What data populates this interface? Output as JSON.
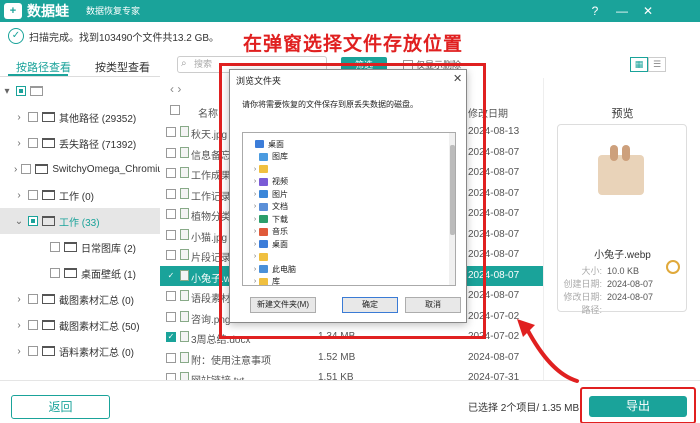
{
  "app": {
    "logo_glyph": "+",
    "title": "数据蛙",
    "subtitle": "数据恢复专家",
    "help_icon": "help-icon",
    "min_icon": "minimize-icon",
    "close_icon": "close-icon"
  },
  "scan": {
    "status": "扫描完成。找到103490个文件共13.2 GB。"
  },
  "annotation": {
    "caption": "在弹窗选择文件存放位置",
    "color": "#e02020"
  },
  "tabs": [
    {
      "label": "按路径查看",
      "active": true
    },
    {
      "label": "按类型查看",
      "active": false
    }
  ],
  "toolbar": {
    "search_placeholder": "搜索",
    "filter_label": "筛选",
    "only_deleted_label": "仅显示删除",
    "views": [
      "▦",
      "☰"
    ]
  },
  "sidebar": {
    "items": [
      {
        "label": "",
        "level": 0,
        "chevron": "▾",
        "check": "partial"
      },
      {
        "label": "其他路径 (29352)",
        "level": 1,
        "chevron": "›",
        "check": "none"
      },
      {
        "label": "丢失路径 (71392)",
        "level": 1,
        "chevron": "›",
        "check": "none"
      },
      {
        "label": "SwitchyOmega_Chromium",
        "level": 1,
        "chevron": "›",
        "check": "none"
      },
      {
        "label": "工作 (0)",
        "level": 1,
        "chevron": "›",
        "check": "none"
      },
      {
        "label": "工作 (33)",
        "level": 1,
        "chevron": "⌄",
        "check": "partial",
        "active": true
      },
      {
        "label": "日常图库 (2)",
        "level": 2,
        "chevron": "",
        "check": "none"
      },
      {
        "label": "桌面壁纸 (1)",
        "level": 2,
        "chevron": "",
        "check": "none"
      },
      {
        "label": "截图素材汇总 (0)",
        "level": 1,
        "chevron": "›",
        "check": "none"
      },
      {
        "label": "截图素材汇总 (50)",
        "level": 1,
        "chevron": "›",
        "check": "none"
      },
      {
        "label": "语料素材汇总 (0)",
        "level": 1,
        "chevron": "›",
        "check": "none"
      }
    ]
  },
  "filelist": {
    "nav": "‹   ›",
    "header": {
      "name": "名称",
      "date": "修改日期"
    },
    "rows": [
      {
        "name": "秋天.jpg",
        "size": "",
        "date": "2024-08-13",
        "checked": false,
        "selected": false
      },
      {
        "name": "信息备忘录.txt",
        "size": "",
        "date": "2024-08-07",
        "checked": false,
        "selected": false
      },
      {
        "name": "工作成果分享",
        "size": "",
        "date": "2024-08-07",
        "checked": false,
        "selected": false
      },
      {
        "name": "工作记录表",
        "size": "",
        "date": "2024-08-07",
        "checked": false,
        "selected": false
      },
      {
        "name": "植物分类.doc",
        "size": "",
        "date": "2024-08-07",
        "checked": false,
        "selected": false
      },
      {
        "name": "小猫.jpg",
        "size": "",
        "date": "2024-08-07",
        "checked": false,
        "selected": false
      },
      {
        "name": "片段记录",
        "size": "",
        "date": "2024-08-07",
        "checked": false,
        "selected": false
      },
      {
        "name": "小兔子.webp",
        "size": "",
        "date": "2024-08-07",
        "checked": true,
        "selected": true
      },
      {
        "name": "语段素材",
        "size": "",
        "date": "2024-08-07",
        "checked": false,
        "selected": false
      },
      {
        "name": "咨询.png",
        "size": "",
        "date": "2024-07-02",
        "checked": false,
        "selected": false
      },
      {
        "name": "3周总结.docx",
        "size": "1.34 MB",
        "date": "2024-07-02",
        "checked": true,
        "selected": false
      },
      {
        "name": "附：使用注意事项",
        "size": "1.52 MB",
        "date": "2024-08-07",
        "checked": false,
        "selected": false
      },
      {
        "name": "网站链接.txt",
        "size": "1.51 KB",
        "date": "2024-07-31",
        "checked": false,
        "selected": false
      },
      {
        "name": "U盘.png",
        "size": "70.7 KB",
        "date": "2024-08-13",
        "checked": false,
        "selected": false
      }
    ]
  },
  "preview": {
    "title": "预览",
    "filename": "小兔子.webp",
    "meta": [
      {
        "k": "大小:",
        "v": "10.0 KB"
      },
      {
        "k": "创建日期:",
        "v": "2024-08-07"
      },
      {
        "k": "修改日期:",
        "v": "2024-08-07"
      },
      {
        "k": "路径:",
        "v": ""
      }
    ]
  },
  "bottom": {
    "back_label": "返回",
    "selection_info": "已选择 2个项目/ 1.35 MB",
    "export_label": "导出"
  },
  "dialog": {
    "title": "浏览文件夹",
    "close": "✕",
    "description": "请你将需要恢复的文件保存到原丢失数据的磁盘。",
    "tree": [
      {
        "label": "桌面",
        "indent": 0,
        "arrow": "",
        "icon_color": "#3c7dd9"
      },
      {
        "label": "图库",
        "indent": 1,
        "arrow": "",
        "icon_color": "#4b9be0"
      },
      {
        "label": "",
        "indent": 1,
        "arrow": "›",
        "icon_color": "#f0c040"
      },
      {
        "label": "视频",
        "indent": 1,
        "arrow": "›",
        "icon_color": "#7a5bd6"
      },
      {
        "label": "图片",
        "indent": 1,
        "arrow": "›",
        "icon_color": "#3a86d9"
      },
      {
        "label": "文档",
        "indent": 1,
        "arrow": "›",
        "icon_color": "#5a8fd8"
      },
      {
        "label": "下载",
        "indent": 1,
        "arrow": "›",
        "icon_color": "#2b9e6b"
      },
      {
        "label": "音乐",
        "indent": 1,
        "arrow": "›",
        "icon_color": "#e05a3a"
      },
      {
        "label": "桌面",
        "indent": 1,
        "arrow": "›",
        "icon_color": "#3c7dd9"
      },
      {
        "label": "",
        "indent": 1,
        "arrow": "›",
        "icon_color": "#f0c040"
      },
      {
        "label": "此电脑",
        "indent": 1,
        "arrow": "›",
        "icon_color": "#4a90d9"
      },
      {
        "label": "库",
        "indent": 1,
        "arrow": "›",
        "icon_color": "#f0c040"
      }
    ],
    "new_folder_label": "新建文件夹(M)",
    "ok_label": "确定",
    "cancel_label": "取消"
  }
}
